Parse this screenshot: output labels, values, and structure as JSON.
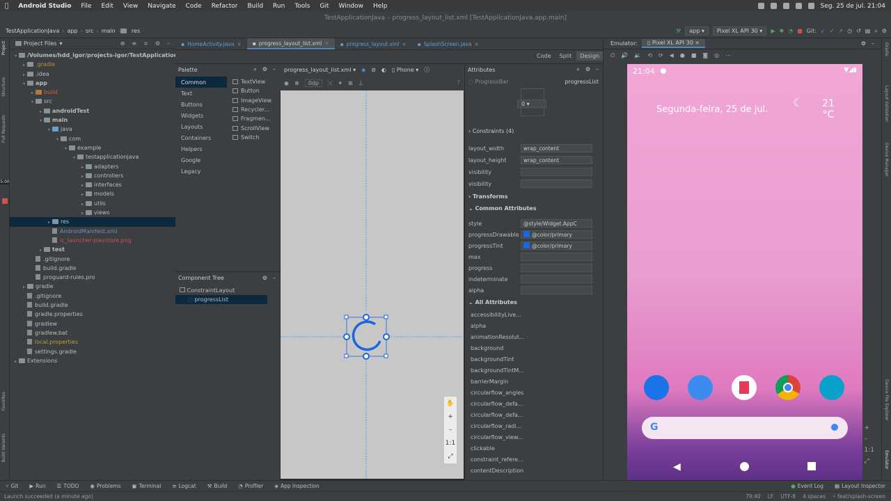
{
  "mac_menu": {
    "app": "Android Studio",
    "items": [
      "File",
      "Edit",
      "View",
      "Navigate",
      "Code",
      "Refactor",
      "Build",
      "Run",
      "Tools",
      "Git",
      "Window",
      "Help"
    ],
    "clock": "Seg. 25 de jul.  21:04"
  },
  "title": "TestApplicationJava – progress_layout_list.xml [TestApplicationJava.app.main]",
  "breadcrumb": [
    "TestApplicationJava",
    "app",
    "src",
    "main",
    "res"
  ],
  "toolbar": {
    "config": "app",
    "device": "Pixel XL API 30",
    "git": "Git:"
  },
  "project": {
    "header": "Project Files",
    "rows": [
      {
        "label": "/Volumes/hdd_igor/projects-igor/TestApplicationJ",
        "indent": 0,
        "arrow": "▾",
        "icon": "fold",
        "bold": true
      },
      {
        "label": ".gradle",
        "indent": 1,
        "arrow": "▸",
        "icon": "fold",
        "color": "#bf8f3b"
      },
      {
        "label": ".idea",
        "indent": 1,
        "arrow": "▸",
        "icon": "fold"
      },
      {
        "label": "app",
        "indent": 1,
        "arrow": "▾",
        "icon": "fold",
        "bold": true
      },
      {
        "label": "build",
        "indent": 2,
        "arrow": "▸",
        "icon": "fold org",
        "color": "#c9663a"
      },
      {
        "label": "src",
        "indent": 2,
        "arrow": "▾",
        "icon": "fold"
      },
      {
        "label": "androidTest",
        "indent": 3,
        "arrow": "▸",
        "icon": "fold",
        "bold": true
      },
      {
        "label": "main",
        "indent": 3,
        "arrow": "▾",
        "icon": "fold",
        "bold": true
      },
      {
        "label": "java",
        "indent": 4,
        "arrow": "▾",
        "icon": "fold blue"
      },
      {
        "label": "com",
        "indent": 5,
        "arrow": "▾",
        "icon": "fold"
      },
      {
        "label": "example",
        "indent": 6,
        "arrow": "▾",
        "icon": "fold"
      },
      {
        "label": "testapplicationjava",
        "indent": 7,
        "arrow": "▾",
        "icon": "fold"
      },
      {
        "label": "adapters",
        "indent": 8,
        "arrow": "▸",
        "icon": "fold"
      },
      {
        "label": "controllers",
        "indent": 8,
        "arrow": "▸",
        "icon": "fold"
      },
      {
        "label": "interfaces",
        "indent": 8,
        "arrow": "▸",
        "icon": "fold"
      },
      {
        "label": "models",
        "indent": 8,
        "arrow": "▸",
        "icon": "fold"
      },
      {
        "label": "utils",
        "indent": 8,
        "arrow": "▸",
        "icon": "fold"
      },
      {
        "label": "views",
        "indent": 8,
        "arrow": "▸",
        "icon": "fold"
      },
      {
        "label": "res",
        "indent": 4,
        "arrow": "▸",
        "icon": "fold",
        "selected": true
      },
      {
        "label": "AndroidManifest.xml",
        "indent": 4,
        "arrow": "",
        "icon": "file",
        "color": "#6f8fb5"
      },
      {
        "label": "ic_launcher-playstore.png",
        "indent": 4,
        "arrow": "",
        "icon": "file",
        "color": "#c75450"
      },
      {
        "label": "test",
        "indent": 3,
        "arrow": "▸",
        "icon": "fold",
        "bold": true
      },
      {
        "label": ".gitignore",
        "indent": 2,
        "arrow": "",
        "icon": "file"
      },
      {
        "label": "build.gradle",
        "indent": 2,
        "arrow": "",
        "icon": "file"
      },
      {
        "label": "proguard-rules.pro",
        "indent": 2,
        "arrow": "",
        "icon": "file"
      },
      {
        "label": "gradle",
        "indent": 1,
        "arrow": "▸",
        "icon": "fold"
      },
      {
        "label": ".gitignore",
        "indent": 1,
        "arrow": "",
        "icon": "file"
      },
      {
        "label": "build.gradle",
        "indent": 1,
        "arrow": "",
        "icon": "file"
      },
      {
        "label": "gradle.properties",
        "indent": 1,
        "arrow": "",
        "icon": "file"
      },
      {
        "label": "gradlew",
        "indent": 1,
        "arrow": "",
        "icon": "file"
      },
      {
        "label": "gradlew.bat",
        "indent": 1,
        "arrow": "",
        "icon": "file"
      },
      {
        "label": "local.properties",
        "indent": 1,
        "arrow": "",
        "icon": "file",
        "color": "#bf9b30"
      },
      {
        "label": "settings.gradle",
        "indent": 1,
        "arrow": "",
        "icon": "file"
      },
      {
        "label": "Extensions",
        "indent": 0,
        "arrow": "▸",
        "icon": "fold"
      }
    ]
  },
  "left_strip": [
    "Project",
    "Structure",
    "Pull Requests",
    "Build Variants",
    "Favorites"
  ],
  "left_strip_time": "5:00",
  "tabs": [
    {
      "label": "HomeActivity.java",
      "active": false
    },
    {
      "label": "progress_layout_list.xml",
      "active": true
    },
    {
      "label": "progress_layout.xml",
      "active": false
    },
    {
      "label": "SplashScreen.java",
      "active": false
    }
  ],
  "view_modes": [
    "Code",
    "Split",
    "Design"
  ],
  "emulator_tab": {
    "label": "Emulator:",
    "device": "Pixel XL API 30"
  },
  "palette": {
    "title": "Palette",
    "categories": [
      "Common",
      "Text",
      "Buttons",
      "Widgets",
      "Layouts",
      "Containers",
      "Helpers",
      "Google",
      "Legacy"
    ],
    "items": [
      "TextView",
      "Button",
      "ImageView",
      "Recycler...",
      "Fragmen...",
      "ScrollView",
      "Switch"
    ]
  },
  "editor_toolbar": {
    "file": "progress_layout_list.xml",
    "device": "Phone",
    "margin": "0dp"
  },
  "component_tree": {
    "title": "Component Tree",
    "root": "ConstraintLayout",
    "child": "progressList"
  },
  "attributes": {
    "title": "Attributes",
    "widget": "ProgressBar",
    "id": "progressList",
    "spinner_value": "0",
    "constraints": "Constraints",
    "constraints_count": "(4)",
    "layout": [
      {
        "name": "layout_width",
        "value": "wrap_content"
      },
      {
        "name": "layout_height",
        "value": "wrap_content"
      },
      {
        "name": "visibility",
        "value": ""
      },
      {
        "name": "visibility",
        "value": ""
      }
    ],
    "transforms": "Transforms",
    "common_title": "Common Attributes",
    "common": [
      {
        "name": "style",
        "value": "@style/Widget.AppC"
      },
      {
        "name": "progressDrawable",
        "value": "@color/primary"
      },
      {
        "name": "progressTint",
        "value": "@color/primary"
      },
      {
        "name": "max",
        "value": ""
      },
      {
        "name": "progress",
        "value": ""
      },
      {
        "name": "indeterminate",
        "value": ""
      },
      {
        "name": "alpha",
        "value": ""
      }
    ],
    "all_title": "All Attributes",
    "all": [
      "accessibilityLive...",
      "alpha",
      "animationResolut...",
      "background",
      "backgroundTint",
      "backgroundTintM...",
      "barrierMargin",
      "circularflow_angles",
      "circularflow_defa...",
      "circularflow_defa...",
      "circularflow_radi...",
      "circularflow_view...",
      "clickable",
      "constraint_refere...",
      "contentDescription"
    ]
  },
  "phone": {
    "time": "21:04",
    "date": "Segunda-feira, 25 de jul.",
    "temp": "21",
    "temp_unit": "°C"
  },
  "bottom_tools": [
    "Git",
    "Run",
    "TODO",
    "Problems",
    "Terminal",
    "Logcat",
    "Build",
    "Profiler",
    "App Inspection"
  ],
  "bottom_right": [
    "Event Log",
    "Layout Inspector"
  ],
  "status": {
    "message": "Launch succeeded (a minute ago)",
    "pos": "79:40",
    "lf": "LF",
    "enc": "UTF-8",
    "indent": "4 spaces",
    "branch": "feat/splash-screen"
  },
  "right_strip": [
    "Gradle",
    "Layout Validation",
    "Device Manager",
    "Device File Explorer",
    "Emulator"
  ],
  "colors": {
    "accent": "#4a88c7",
    "progress": "#1a66e0",
    "selection": "#0d293e"
  }
}
